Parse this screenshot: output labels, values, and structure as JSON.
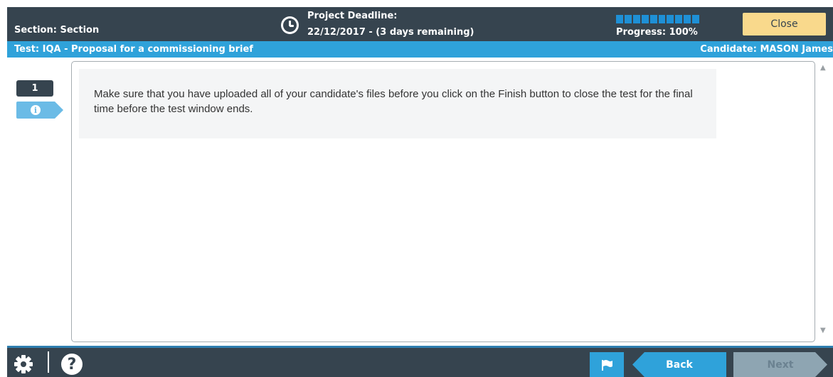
{
  "header": {
    "section_label": "Section: Section",
    "deadline_title": "Project Deadline:",
    "deadline_value": "22/12/2017 - (3 days remaining)",
    "progress": 1.0,
    "progress_label": "Progress: 100%",
    "close_label": "Close"
  },
  "testbar": {
    "test_title": "Test: IQA - Proposal for a commissioning brief",
    "candidate": "Candidate: MASON James"
  },
  "question_nav": {
    "number": "1",
    "info_glyph": "i"
  },
  "content": {
    "message": "Make sure that you have uploaded all of your candidate's files before you click on the Finish button to close the test for the final time before the test window ends."
  },
  "footer": {
    "help_glyph": "?",
    "back_label": "Back",
    "next_label": "Next"
  },
  "icons": {
    "clock": "clock-icon",
    "info": "info-icon",
    "gear": "gear-icon",
    "help": "help-icon",
    "flag": "flag-icon",
    "scroll_up": "scroll-up-arrow-icon",
    "scroll_down": "scroll-down-arrow-icon"
  },
  "colors": {
    "header_bg": "#36444f",
    "accent_blue": "#2fa2da",
    "close_button": "#f9d98c",
    "info_tab": "#6bbbe6",
    "next_disabled": "#8ea5b2"
  }
}
